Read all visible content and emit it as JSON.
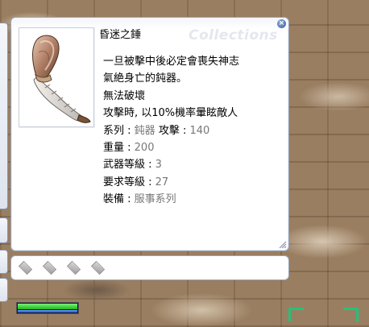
{
  "window": {
    "watermark": "Collections",
    "close_label": "×",
    "title": "昏迷之錘"
  },
  "description": {
    "line1": "一旦被擊中後必定會喪失神志",
    "line2": "氣絶身亡的鈍器。",
    "line3": "無法破壞",
    "line4": "攻擊時, 以10%機率暈眩敵人",
    "type_label": "系列 :",
    "type_value": "鈍器",
    "attack_label": "攻擊 :",
    "attack_value": "140",
    "weight_label": "重量 :",
    "weight_value": "200",
    "weapon_level_label": "武器等級 :",
    "weapon_level_value": "3",
    "required_level_label": "要求等級 :",
    "required_level_value": "27",
    "equip_label": "裝備 :",
    "equip_value": "服事系列"
  },
  "card_slots": 4,
  "status": {
    "hp_fraction": 1.0,
    "sp_fraction": 1.0
  },
  "colors": {
    "window_border": "#9aa4b8",
    "value_text": "#777777",
    "hp": "#19b819",
    "sp": "#1f4fcf",
    "target_bracket": "#27c07a"
  }
}
